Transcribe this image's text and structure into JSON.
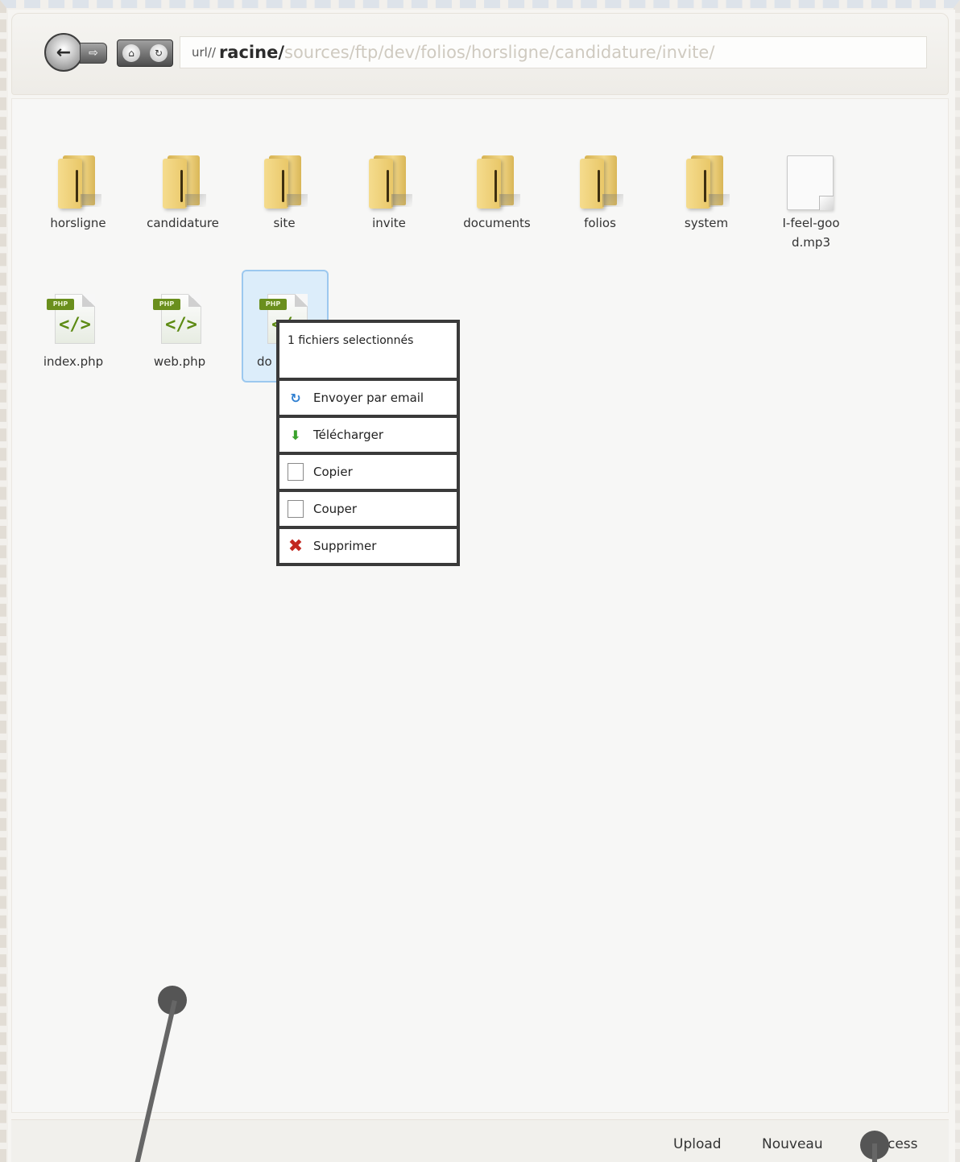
{
  "toolbar": {
    "back_glyph": "←",
    "forward_glyph": "⇨",
    "home_glyph": "⌂",
    "refresh_glyph": "↻",
    "address": {
      "prefix": "url//",
      "root": "racine/",
      "rest": "sources/ftp/dev/folios/horsligne/candidature/invite/"
    }
  },
  "files": {
    "folders": [
      {
        "label": "horsligne"
      },
      {
        "label": "candidature"
      },
      {
        "label": "site"
      },
      {
        "label": "invite"
      },
      {
        "label": "documents"
      },
      {
        "label": "folios"
      },
      {
        "label": "system"
      }
    ],
    "mp3_label": "I-feel-good.mp3",
    "php_files": [
      {
        "label": "index.php",
        "tag": "PHP",
        "code": "</>"
      },
      {
        "label": "web.php",
        "tag": "PHP",
        "code": "</>"
      },
      {
        "label": "do",
        "tag": "PHP",
        "code": "</>"
      }
    ]
  },
  "context_menu": {
    "header": "1 fichiers selectionnés",
    "items": [
      {
        "label": "Envoyer par email",
        "icon": "refresh-email-icon",
        "glyph": "↻"
      },
      {
        "label": "Télécharger",
        "icon": "download-arrow-icon",
        "glyph": "⬇"
      },
      {
        "label": "Copier",
        "icon": "copy-icon",
        "glyph": ""
      },
      {
        "label": "Couper",
        "icon": "cut-icon",
        "glyph": ""
      },
      {
        "label": "Supprimer",
        "icon": "delete-icon",
        "glyph": "✖"
      }
    ]
  },
  "bottom": {
    "upload": "Upload",
    "nouveau": "Nouveau",
    "acces": "cess"
  },
  "colors": {
    "selection": "#dcedfa",
    "selection_border": "#9cc8ef",
    "folder": "#f3d98a",
    "php_green": "#5c8a12"
  }
}
